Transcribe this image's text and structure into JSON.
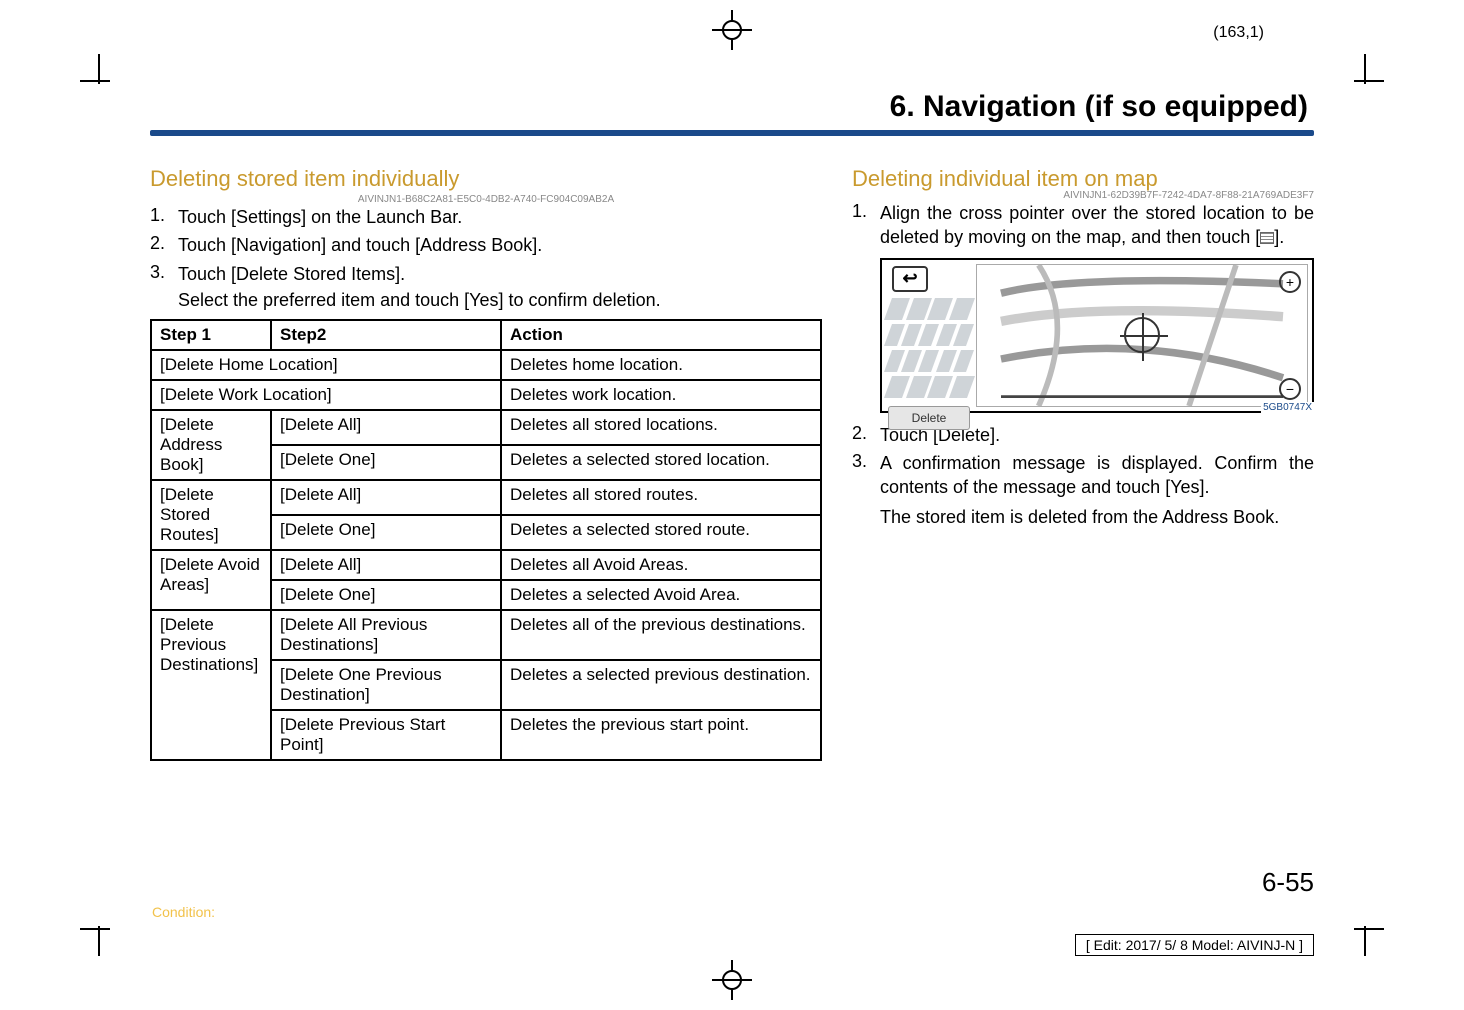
{
  "page_marker_top": "(163,1)",
  "chapter_title": "6. Navigation (if so equipped)",
  "left": {
    "subhead": "Deleting stored item individually",
    "uid": "AIVINJN1-B68C2A81-E5C0-4DB2-A740-FC904C09AB2A",
    "steps": [
      "Touch [Settings] on the Launch Bar.",
      "Touch [Navigation] and touch [Address Book].",
      "Touch [Delete Stored Items]."
    ],
    "sub_text": "Select the preferred item and touch [Yes] to confirm deletion.",
    "table": {
      "head": [
        "Step 1",
        "Step2",
        "Action"
      ],
      "rows": [
        {
          "c1": "[Delete Home Location]",
          "c1span": 2,
          "c3": "Deletes home location."
        },
        {
          "c1": "[Delete Work Location]",
          "c1span": 2,
          "c3": "Deletes work location."
        },
        {
          "c1": "[Delete Address Book]",
          "rowspan": 2,
          "c2": "[Delete All]",
          "c3": "Deletes all stored locations."
        },
        {
          "c2": "[Delete One]",
          "c3": "Deletes a selected stored location."
        },
        {
          "c1": "[Delete Stored Routes]",
          "rowspan": 2,
          "c2": "[Delete All]",
          "c3": "Deletes all stored routes."
        },
        {
          "c2": "[Delete One]",
          "c3": "Deletes a selected stored route."
        },
        {
          "c1": "[Delete Avoid Areas]",
          "rowspan": 2,
          "c2": "[Delete All]",
          "c3": "Deletes all Avoid Areas."
        },
        {
          "c2": "[Delete One]",
          "c3": "Deletes a selected Avoid Area."
        },
        {
          "c1": "[Delete Previous Destinations]",
          "rowspan": 3,
          "c2": "[Delete All Previous Destinations]",
          "c3": "Deletes all of the previous destinations."
        },
        {
          "c2": "[Delete One Previous Destination]",
          "c3": "Deletes a selected previous destination."
        },
        {
          "c2": "[Delete Previous Start Point]",
          "c3": "Deletes the previous start point."
        }
      ]
    }
  },
  "right": {
    "subhead": "Deleting individual item on map",
    "uid": "AIVINJN1-62D39B7F-7242-4DA7-8F88-21A769ADE3F7",
    "step1_pre": "Align the cross pointer over the stored location to be deleted by moving on the map, and then touch [",
    "step1_post": "].",
    "fig_delete_label": "Delete",
    "fig_id": "5GB0747X",
    "step2": "Touch [Delete].",
    "step3a": "A confirmation message is displayed. Confirm the contents of the message and touch [Yes].",
    "step3b": "The stored item is deleted from the Address Book."
  },
  "page_num": "6-55",
  "condition_label": "Condition:",
  "edit_stamp": "[ Edit: 2017/ 5/ 8   Model:  AIVINJ-N ]"
}
